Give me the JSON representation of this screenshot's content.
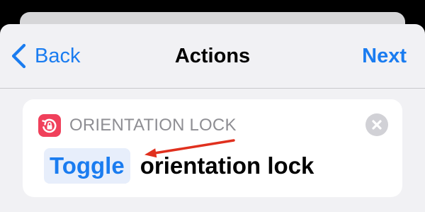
{
  "navbar": {
    "back_label": "Back",
    "title": "Actions",
    "next_label": "Next"
  },
  "action_card": {
    "name": "ORIENTATION LOCK",
    "icon": "orientation-lock-icon",
    "parameter_value": "Toggle",
    "trailing_text": "orientation lock"
  },
  "annotation": {
    "type": "arrow",
    "points_to": "Toggle"
  },
  "colors": {
    "accent": "#1a7cf0",
    "icon_background": "#f0405b",
    "annotation_arrow": "#e0301e",
    "sheet_background": "#f1f1f4",
    "card_background": "#ffffff",
    "token_background": "#e7eefb",
    "secondary_text": "#8e8e93"
  }
}
